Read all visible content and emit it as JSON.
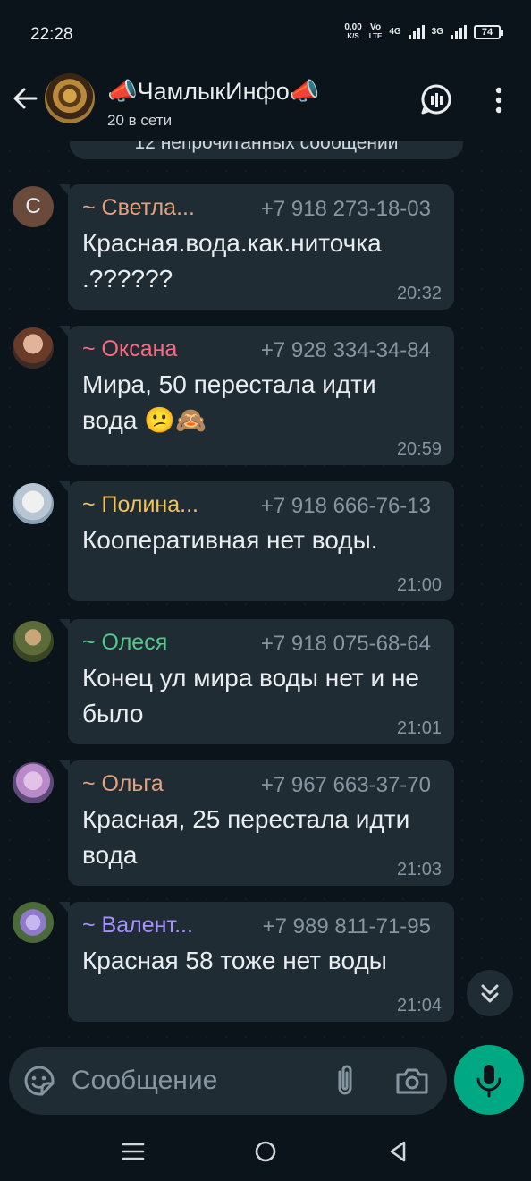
{
  "status_bar": {
    "time": "22:28",
    "speed_value": "0,00",
    "speed_unit": "K/S",
    "vo_label": "Vo",
    "lte_label": "LTE",
    "net1": "4G",
    "net2": "3G",
    "battery": "74"
  },
  "header": {
    "title": "📣ЧамлыкИнфо📣",
    "subtitle": "20 в сети"
  },
  "unread_banner": "12 непрочитанных сообщений",
  "messages": [
    {
      "avatar_letter": "С",
      "sender": "~ Светла...",
      "sender_color": "#e5a17d",
      "phone": "+7 918 273-18-03",
      "text": "Красная.вода.как.ниточка .??????",
      "time": "20:32"
    },
    {
      "sender": "~ Оксана",
      "sender_color": "#fc6a82",
      "phone": "+7 928 334-34-84",
      "text": "Мира, 50 перестала идти вода 😕🙈",
      "time": "20:59"
    },
    {
      "sender": "~ Полина...",
      "sender_color": "#f2c25b",
      "phone": "+7 918 666-76-13",
      "text": "Кооперативная нет воды.",
      "time": "21:00"
    },
    {
      "sender": "~ Олеся",
      "sender_color": "#53c98b",
      "phone": "+7 918 075-68-64",
      "text": "Конец ул мира воды нет и не было",
      "time": "21:01"
    },
    {
      "sender": "~ Ольга",
      "sender_color": "#e5a17d",
      "phone": "+7 967 663-37-70",
      "text": "Красная, 25 перестала идти вода",
      "time": "21:03"
    },
    {
      "sender": "~ Валент...",
      "sender_color": "#a791ff",
      "phone": "+7 989 811-71-95",
      "text": "Красная 58 тоже нет воды",
      "time": "21:04"
    }
  ],
  "composer": {
    "placeholder": "Сообщение"
  },
  "colors": {
    "background": "#0b141a",
    "bubble": "#1f2c34",
    "accent": "#00a884"
  }
}
